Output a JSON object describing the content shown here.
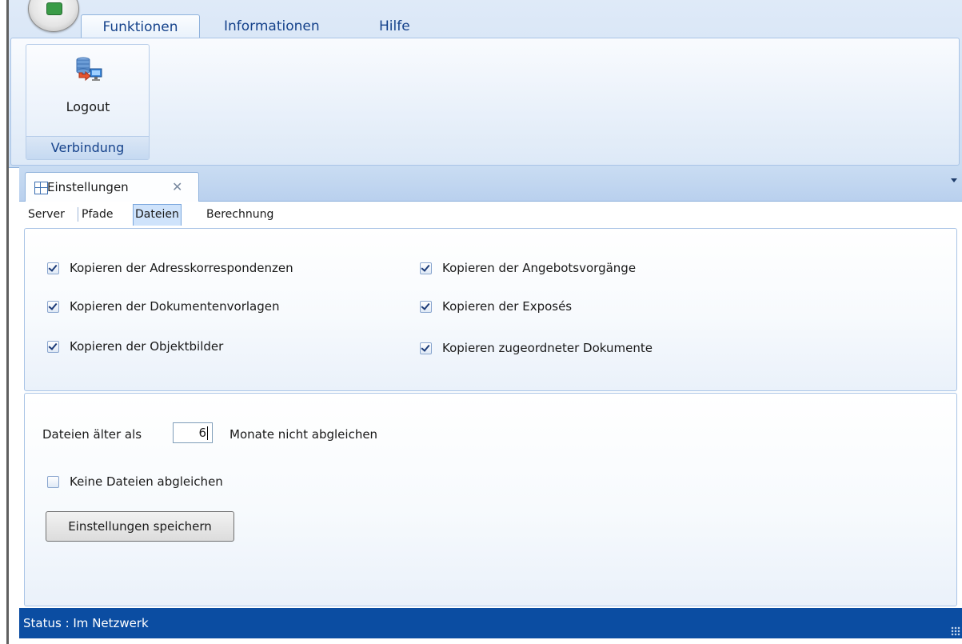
{
  "ribbon": {
    "tabs": [
      {
        "label": "Funktionen",
        "active": true
      },
      {
        "label": "Informationen",
        "active": false
      },
      {
        "label": "Hilfe",
        "active": false
      }
    ],
    "group": {
      "button_label": "Logout",
      "caption": "Verbindung"
    }
  },
  "document_tab": {
    "title": "Einstellungen",
    "close_symbol": "✕"
  },
  "settings_tabs": [
    {
      "label": "Server",
      "active": false
    },
    {
      "label": "Pfade",
      "active": false
    },
    {
      "label": "Dateien",
      "active": true
    },
    {
      "label": "Berechnung",
      "active": false
    }
  ],
  "copy_options": [
    {
      "label": "Kopieren der Adresskorrespondenzen",
      "checked": true
    },
    {
      "label": "Kopieren der Angebotsvorgänge",
      "checked": true
    },
    {
      "label": "Kopieren der Dokumentenvorlagen",
      "checked": true
    },
    {
      "label": "Kopieren der Exposés",
      "checked": true
    },
    {
      "label": "Kopieren der Objektbilder",
      "checked": true
    },
    {
      "label": "Kopieren zugeordneter Dokumente",
      "checked": true
    }
  ],
  "sync": {
    "prefix_label": "Dateien älter als",
    "months_value": "6",
    "suffix_label": "Monate nicht abgleichen",
    "no_sync_label": "Keine Dateien abgleichen",
    "no_sync_checked": false,
    "save_label": "Einstellungen speichern"
  },
  "status": {
    "text": "Status : Im Netzwerk"
  },
  "colors": {
    "status_bar": "#0b4da2",
    "ribbon_text": "#15428b",
    "active_subtab": "#cfe3fb"
  }
}
